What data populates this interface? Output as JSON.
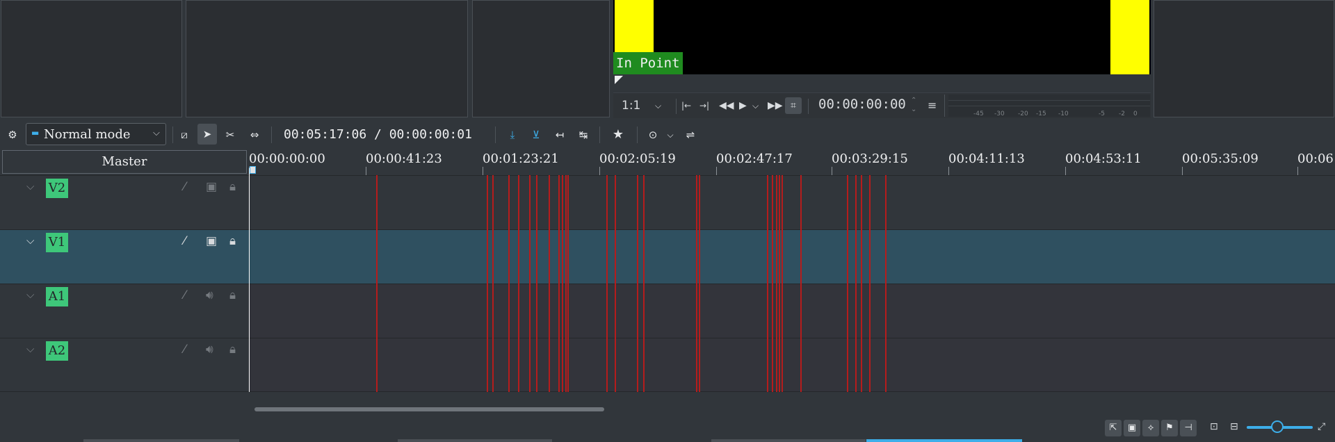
{
  "monitor": {
    "in_point_label": "In Point",
    "zoom_ratio": "1:1",
    "timecode": "00:00:00:00",
    "meter_ticks": [
      "-45",
      "-30",
      "-20",
      "-15",
      "-10",
      "-5",
      "-2",
      "0"
    ]
  },
  "toolbar": {
    "mode": "Normal mode",
    "timecode": "00:05:17:06 / 00:00:00:01"
  },
  "timeline": {
    "master_label": "Master",
    "ruler_labels": [
      "00:00:00:00",
      "00:00:41:23",
      "00:01:23:21",
      "00:02:05:19",
      "00:02:47:17",
      "00:03:29:15",
      "00:04:11:13",
      "00:04:53:11",
      "00:05:35:09",
      "00:06"
    ],
    "tracks": [
      {
        "name": "V2",
        "kind": "video"
      },
      {
        "name": "V1",
        "kind": "video",
        "selected": true
      },
      {
        "name": "A1",
        "kind": "audio"
      },
      {
        "name": "A2",
        "kind": "audio"
      }
    ]
  },
  "colors": {
    "accent": "#3daee9",
    "track_tag": "#3ec77a",
    "in_point_bg": "#1f8b1f",
    "marker": "#b61c1c",
    "selected_track": "#2f5060"
  }
}
